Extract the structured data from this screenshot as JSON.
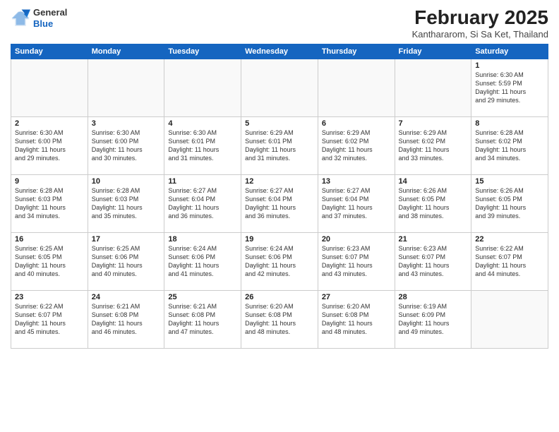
{
  "header": {
    "logo_line1": "General",
    "logo_line2": "Blue",
    "month_year": "February 2025",
    "location": "Kanthararom, Si Sa Ket, Thailand"
  },
  "days_of_week": [
    "Sunday",
    "Monday",
    "Tuesday",
    "Wednesday",
    "Thursday",
    "Friday",
    "Saturday"
  ],
  "weeks": [
    [
      {
        "day": "",
        "info": ""
      },
      {
        "day": "",
        "info": ""
      },
      {
        "day": "",
        "info": ""
      },
      {
        "day": "",
        "info": ""
      },
      {
        "day": "",
        "info": ""
      },
      {
        "day": "",
        "info": ""
      },
      {
        "day": "1",
        "info": "Sunrise: 6:30 AM\nSunset: 5:59 PM\nDaylight: 11 hours\nand 29 minutes."
      }
    ],
    [
      {
        "day": "2",
        "info": "Sunrise: 6:30 AM\nSunset: 6:00 PM\nDaylight: 11 hours\nand 29 minutes."
      },
      {
        "day": "3",
        "info": "Sunrise: 6:30 AM\nSunset: 6:00 PM\nDaylight: 11 hours\nand 30 minutes."
      },
      {
        "day": "4",
        "info": "Sunrise: 6:30 AM\nSunset: 6:01 PM\nDaylight: 11 hours\nand 31 minutes."
      },
      {
        "day": "5",
        "info": "Sunrise: 6:29 AM\nSunset: 6:01 PM\nDaylight: 11 hours\nand 31 minutes."
      },
      {
        "day": "6",
        "info": "Sunrise: 6:29 AM\nSunset: 6:02 PM\nDaylight: 11 hours\nand 32 minutes."
      },
      {
        "day": "7",
        "info": "Sunrise: 6:29 AM\nSunset: 6:02 PM\nDaylight: 11 hours\nand 33 minutes."
      },
      {
        "day": "8",
        "info": "Sunrise: 6:28 AM\nSunset: 6:02 PM\nDaylight: 11 hours\nand 34 minutes."
      }
    ],
    [
      {
        "day": "9",
        "info": "Sunrise: 6:28 AM\nSunset: 6:03 PM\nDaylight: 11 hours\nand 34 minutes."
      },
      {
        "day": "10",
        "info": "Sunrise: 6:28 AM\nSunset: 6:03 PM\nDaylight: 11 hours\nand 35 minutes."
      },
      {
        "day": "11",
        "info": "Sunrise: 6:27 AM\nSunset: 6:04 PM\nDaylight: 11 hours\nand 36 minutes."
      },
      {
        "day": "12",
        "info": "Sunrise: 6:27 AM\nSunset: 6:04 PM\nDaylight: 11 hours\nand 36 minutes."
      },
      {
        "day": "13",
        "info": "Sunrise: 6:27 AM\nSunset: 6:04 PM\nDaylight: 11 hours\nand 37 minutes."
      },
      {
        "day": "14",
        "info": "Sunrise: 6:26 AM\nSunset: 6:05 PM\nDaylight: 11 hours\nand 38 minutes."
      },
      {
        "day": "15",
        "info": "Sunrise: 6:26 AM\nSunset: 6:05 PM\nDaylight: 11 hours\nand 39 minutes."
      }
    ],
    [
      {
        "day": "16",
        "info": "Sunrise: 6:25 AM\nSunset: 6:05 PM\nDaylight: 11 hours\nand 40 minutes."
      },
      {
        "day": "17",
        "info": "Sunrise: 6:25 AM\nSunset: 6:06 PM\nDaylight: 11 hours\nand 40 minutes."
      },
      {
        "day": "18",
        "info": "Sunrise: 6:24 AM\nSunset: 6:06 PM\nDaylight: 11 hours\nand 41 minutes."
      },
      {
        "day": "19",
        "info": "Sunrise: 6:24 AM\nSunset: 6:06 PM\nDaylight: 11 hours\nand 42 minutes."
      },
      {
        "day": "20",
        "info": "Sunrise: 6:23 AM\nSunset: 6:07 PM\nDaylight: 11 hours\nand 43 minutes."
      },
      {
        "day": "21",
        "info": "Sunrise: 6:23 AM\nSunset: 6:07 PM\nDaylight: 11 hours\nand 43 minutes."
      },
      {
        "day": "22",
        "info": "Sunrise: 6:22 AM\nSunset: 6:07 PM\nDaylight: 11 hours\nand 44 minutes."
      }
    ],
    [
      {
        "day": "23",
        "info": "Sunrise: 6:22 AM\nSunset: 6:07 PM\nDaylight: 11 hours\nand 45 minutes."
      },
      {
        "day": "24",
        "info": "Sunrise: 6:21 AM\nSunset: 6:08 PM\nDaylight: 11 hours\nand 46 minutes."
      },
      {
        "day": "25",
        "info": "Sunrise: 6:21 AM\nSunset: 6:08 PM\nDaylight: 11 hours\nand 47 minutes."
      },
      {
        "day": "26",
        "info": "Sunrise: 6:20 AM\nSunset: 6:08 PM\nDaylight: 11 hours\nand 48 minutes."
      },
      {
        "day": "27",
        "info": "Sunrise: 6:20 AM\nSunset: 6:08 PM\nDaylight: 11 hours\nand 48 minutes."
      },
      {
        "day": "28",
        "info": "Sunrise: 6:19 AM\nSunset: 6:09 PM\nDaylight: 11 hours\nand 49 minutes."
      },
      {
        "day": "",
        "info": ""
      }
    ]
  ]
}
